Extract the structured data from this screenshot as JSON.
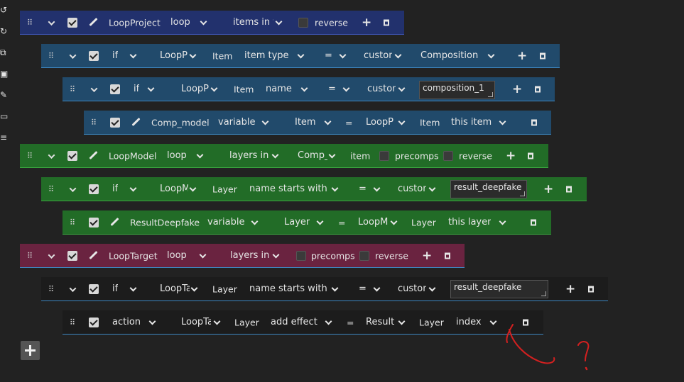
{
  "toolbar": {
    "icons": [
      "undo-icon",
      "redo-icon",
      "copy-icon",
      "paste-icon",
      "pencil-icon",
      "window-icon",
      "list-add-icon"
    ]
  },
  "rows": {
    "r1": {
      "name": "LoopProject",
      "mode": "loop",
      "source": "items in t",
      "reverse_label": "reverse"
    },
    "r2": {
      "kind": "if",
      "loop_ref": "LoopP",
      "item_label": "Item",
      "field": "item type",
      "op": "=",
      "mode": "custom",
      "value": "Composition"
    },
    "r3": {
      "kind": "if",
      "loop_ref": "LoopP",
      "item_label": "Item",
      "field": "name",
      "op": "=",
      "mode": "custom",
      "value": "composition_1"
    },
    "r4": {
      "name": "Comp_model",
      "mode": "variable",
      "target": "Item",
      "op": "=",
      "loop_ref": "LoopP",
      "item_label": "Item",
      "field": "this item"
    },
    "r5": {
      "name": "LoopModel",
      "mode": "loop",
      "source": "layers in",
      "comp_ref": "Comp_",
      "item_label": "item",
      "precomps_label": "precomps",
      "reverse_label": "reverse"
    },
    "r6": {
      "kind": "if",
      "loop_ref": "LoopM",
      "item_label": "Layer",
      "field": "name starts with",
      "op": "=",
      "mode": "custom",
      "value": "result_deepfake"
    },
    "r7": {
      "name": "ResultDeepfake",
      "mode": "variable",
      "target": "Layer",
      "op": "=",
      "loop_ref": "LoopM",
      "item_label": "Layer",
      "field": "this layer"
    },
    "r8": {
      "name": "LoopTarget",
      "mode": "loop",
      "source": "layers in",
      "precomps_label": "precomps",
      "reverse_label": "reverse"
    },
    "r9": {
      "kind": "if",
      "loop_ref": "LoopTa",
      "item_label": "Layer",
      "field": "name starts with",
      "op": "=",
      "mode": "custom",
      "value": "result_deepfake"
    },
    "r10": {
      "kind": "action",
      "loop_ref": "LoopTa",
      "item_label": "Layer",
      "field": "add effect",
      "op": "=",
      "ref2": "Result",
      "item_label2": "Layer",
      "field2": "index"
    }
  },
  "colors": {
    "blue": "#22316d",
    "teal": "#214a6b",
    "green": "#226c27",
    "maroon": "#6a2340",
    "dark": "#1c1c1c",
    "annotation": "#d42020"
  }
}
